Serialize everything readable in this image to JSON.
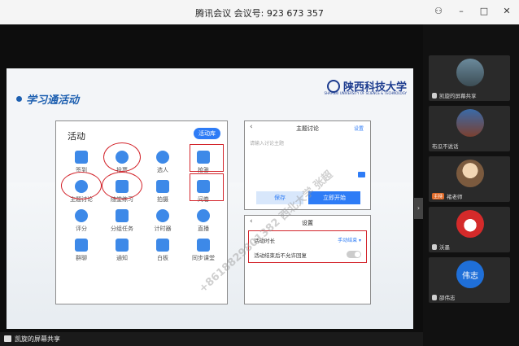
{
  "window": {
    "title": "腾讯会议 会议号: 923 673 357",
    "controls": [
      "⚇",
      "–",
      "□",
      "✕"
    ]
  },
  "slide": {
    "title": "学习通活动",
    "logo_text": "陕西科技大学",
    "logo_sub": "SHAANXI UNIVERSITY OF SCIENCE & TECHNOLOGY",
    "activity_panel": {
      "title": "活动",
      "library_button": "活动库",
      "items": [
        "签到",
        "投票",
        "选人",
        "抢答",
        "主题讨论",
        "随堂练习",
        "拍摄",
        "问卷",
        "评分",
        "分组任务",
        "计时器",
        "直播",
        "群聊",
        "通知",
        "白板",
        "同步课堂"
      ]
    },
    "discussion_panel": {
      "title": "主题讨论",
      "settings_link": "设置",
      "placeholder": "请输入讨论主题",
      "save": "保存",
      "start": "立即开始"
    },
    "settings_panel": {
      "title": "设置",
      "duration_label": "活动时长",
      "duration_value": "手动结束 ▾",
      "no_reply_label": "活动结束后不允许回复"
    },
    "watermark": "+8618829801382 西北大学 张超"
  },
  "bottom_bar": {
    "share_label": "凯旋的屏幕共享"
  },
  "participants": [
    {
      "name": "凯旋的屏幕共享",
      "badge": ""
    },
    {
      "name": "布瓜不说话",
      "badge": ""
    },
    {
      "name": "褚老师",
      "badge": "主持"
    },
    {
      "name": "沃墨",
      "badge": ""
    },
    {
      "name": "邵伟志",
      "badge": "",
      "initials": "伟志"
    }
  ],
  "colors": {
    "accent": "#2e7cf6",
    "highlight": "#d3232a",
    "school": "#1d3c8f"
  }
}
